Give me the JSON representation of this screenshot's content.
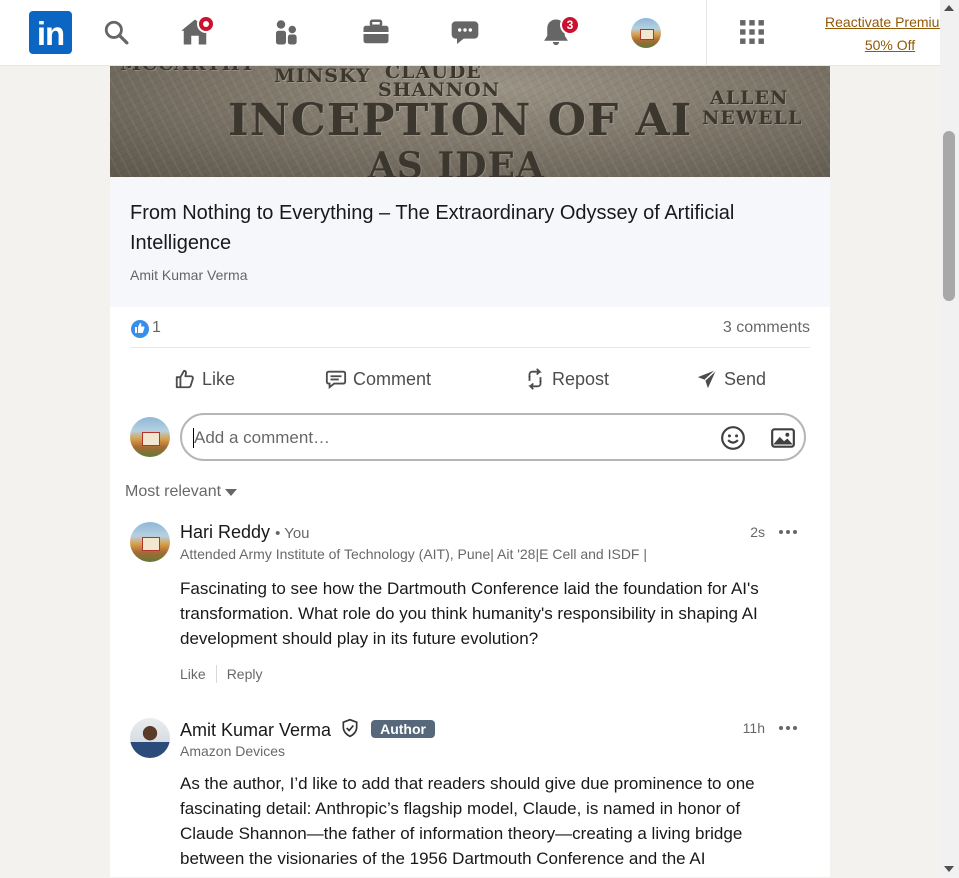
{
  "nav": {
    "logo_text": "in",
    "notifications_count": "3",
    "premium_line1": "Reactivate Premium:",
    "premium_line2": "50% Off",
    "brand_color": "#0a66c2",
    "badge_color": "#cb112d"
  },
  "hero": {
    "names": [
      "MCCARTHY",
      "MINSKY",
      "CLAUDE",
      "SHANNON",
      "ALLEN",
      "NEWELL"
    ],
    "headline_line1": "INCEPTION OF AI",
    "headline_line2": "AS IDEA"
  },
  "article": {
    "title": "From Nothing to Everything – The Extraordinary Odyssey of Artificial Intelligence",
    "author": "Amit Kumar Verma"
  },
  "social": {
    "likes": "1",
    "comments": "3 comments"
  },
  "actions": {
    "like": "Like",
    "comment": "Comment",
    "repost": "Repost",
    "send": "Send"
  },
  "comment_box": {
    "placeholder": "Add a comment…"
  },
  "sort": {
    "label": "Most relevant"
  },
  "comments": [
    {
      "name": "Hari Reddy",
      "you": "• You",
      "headline": "Attended Army Institute of Technology (AIT), Pune| Ait '28|E Cell and ISDF |",
      "time": "2s",
      "text": "Fascinating to see how the Dartmouth Conference laid the foundation for AI's transformation. What role do you think humanity's responsibility in shaping AI development should play in its future evolution?",
      "like": "Like",
      "reply": "Reply"
    },
    {
      "name": "Amit Kumar Verma",
      "badge": "Author",
      "headline": "Amazon Devices",
      "time": "11h",
      "text": "As the author, I’d like to add that readers should give due prominence to one fascinating detail: Anthropic’s flagship model, Claude, is named in honor of Claude Shannon—the father of information theory—creating a living bridge between the visionaries of the 1956 Dartmouth Conference and the AI"
    }
  ]
}
